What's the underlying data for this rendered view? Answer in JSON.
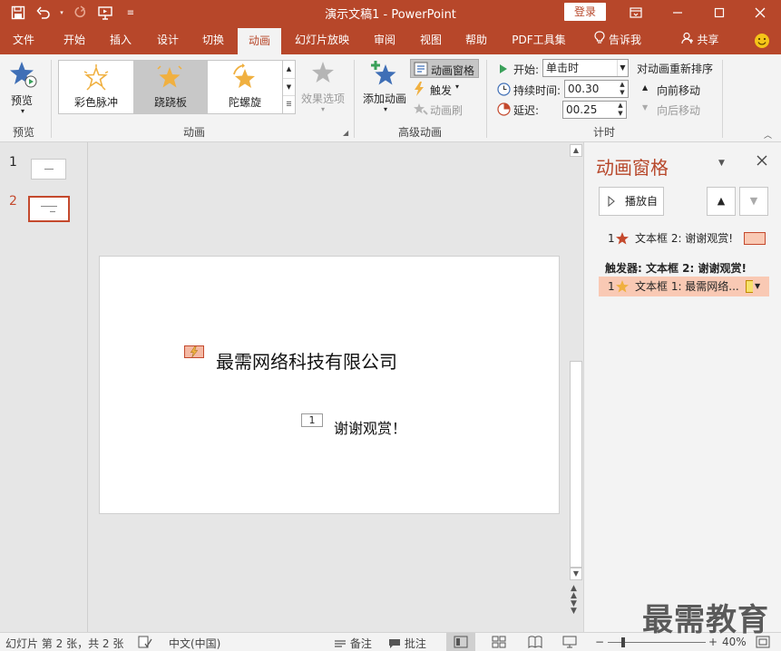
{
  "window": {
    "title": "演示文稿1  -  PowerPoint",
    "login_label": "登录"
  },
  "tabs": [
    {
      "label": "文件"
    },
    {
      "label": "开始"
    },
    {
      "label": "插入"
    },
    {
      "label": "设计"
    },
    {
      "label": "切换"
    },
    {
      "label": "动画"
    },
    {
      "label": "幻灯片放映"
    },
    {
      "label": "审阅"
    },
    {
      "label": "视图"
    },
    {
      "label": "帮助"
    },
    {
      "label": "PDF工具集"
    },
    {
      "label": "告诉我"
    },
    {
      "label": "共享"
    }
  ],
  "active_tab": "动画",
  "ribbon": {
    "preview": {
      "label": "预览",
      "group": "预览"
    },
    "animation_group": "动画",
    "gallery": [
      {
        "label": "彩色脉冲"
      },
      {
        "label": "跷跷板"
      },
      {
        "label": "陀螺旋"
      }
    ],
    "effect_options": "效果选项",
    "advanced": {
      "add_animation": "添加动画",
      "animation_pane": "动画窗格",
      "trigger": "触发",
      "animation_painter": "动画刷",
      "group": "高级动画"
    },
    "timing": {
      "start_label": "开始:",
      "start_value": "单击时",
      "duration_label": "持续时间:",
      "duration_value": "00.30",
      "delay_label": "延迟:",
      "delay_value": "00.25",
      "reorder_label": "对动画重新排序",
      "move_earlier": "向前移动",
      "move_later": "向后移动",
      "group": "计时"
    }
  },
  "slides": [
    {
      "number": "1"
    },
    {
      "number": "2"
    }
  ],
  "slide_content": {
    "title_text": "最需网络科技有限公司",
    "subtitle_text": "谢谢观赏！",
    "anim_tag_number": "1"
  },
  "animation_pane": {
    "title": "动画窗格",
    "play_label": "播放自",
    "items": [
      {
        "number": "1",
        "label": "文本框 2: 谢谢观赏!"
      }
    ],
    "trigger_header": "触发器: 文本框 2: 谢谢观赏!",
    "trigger_items": [
      {
        "number": "1",
        "label": "文本框 1: 最需网络..."
      }
    ]
  },
  "status": {
    "slide_info": "幻灯片 第 2 张，共 2 张",
    "language": "中文(中国)",
    "notes": "备注",
    "comments": "批注",
    "zoom": "40%"
  },
  "watermark": "最需教育",
  "colors": {
    "accent": "#b7472a",
    "ribbon_bg": "#f3f3f3",
    "selection": "#f9c9b4"
  }
}
